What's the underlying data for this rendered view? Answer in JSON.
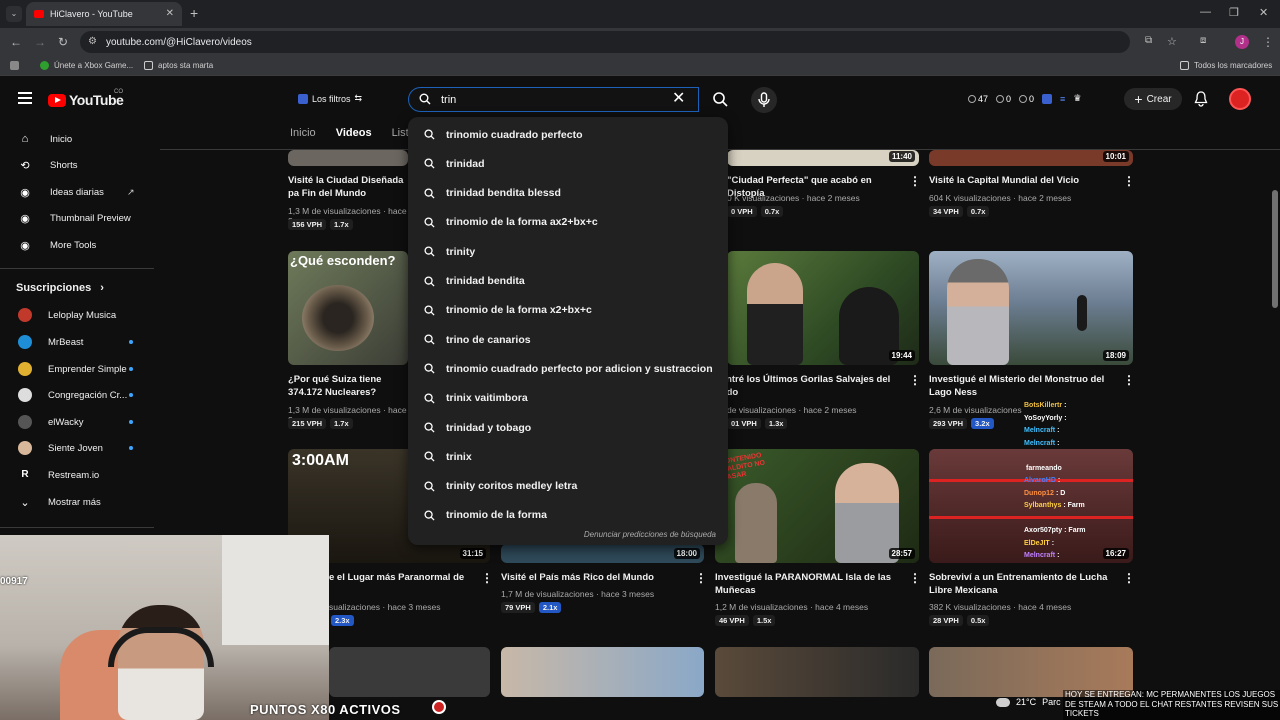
{
  "browser": {
    "tab_title": "HiClavero - YouTube",
    "url": "youtube.com/@HiClavero/videos",
    "bookmarks": [
      "Únete a Xbox Game...",
      "aptos sta marta"
    ],
    "all_bookmarks": "Todos los marcadores",
    "profile_initial": "J"
  },
  "header": {
    "logo_text": "YouTube",
    "logo_region": "CO",
    "filters_label": "Los filtros",
    "search_value": "trin",
    "stats": [
      "47",
      "0",
      "0"
    ],
    "create_label": "Crear"
  },
  "sidebar": {
    "items": [
      {
        "label": "Inicio",
        "icon": "home-icon"
      },
      {
        "label": "Shorts",
        "icon": "shorts-icon"
      },
      {
        "label": "Ideas diarias",
        "icon": "ideas-icon"
      },
      {
        "label": "Thumbnail Preview",
        "icon": "thumbnail-icon"
      },
      {
        "label": "More Tools",
        "icon": "tools-icon"
      }
    ],
    "subscriptions_title": "Suscripciones",
    "subscriptions": [
      {
        "name": "Leloplay Musica",
        "color": "#c0392b",
        "dot": false
      },
      {
        "name": "MrBeast",
        "color": "#1e8fd6",
        "dot": true
      },
      {
        "name": "Emprender Simple",
        "color": "#e0b030",
        "dot": true
      },
      {
        "name": "Congregación Cr...",
        "color": "#dddddd",
        "dot": true
      },
      {
        "name": "elWacky",
        "color": "#555555",
        "dot": true
      },
      {
        "name": "Siente Joven",
        "color": "#d8b89a",
        "dot": true
      },
      {
        "name": "Restream.io",
        "color": "#0f0f0f",
        "dot": false
      }
    ],
    "show_more": "Mostrar más"
  },
  "channel_tabs": [
    "Inicio",
    "Videos",
    "Lista"
  ],
  "suggestions": [
    "trinomio cuadrado perfecto",
    "trinidad",
    "trinidad bendita blessd",
    "trinomio de la forma ax2+bx+c",
    "trinity",
    "trinidad bendita",
    "trinomio de la forma x2+bx+c",
    "trino de canarios",
    "trinomio cuadrado perfecto por adicion y sustraccion",
    "trinix vaitimbora",
    "trinidad y tobago",
    "trinix",
    "trinity coritos medley letra",
    "trinomio de la forma"
  ],
  "report_predictions": "Denunciar predicciones de búsqueda",
  "videos": {
    "row1": [
      {
        "title": "Visité la Ciudad Diseñada pa Fin del Mundo",
        "meta": "1,3 M de visualizaciones · hace 2",
        "vph": "156 VPH",
        "mult": "1.7x",
        "duration": ""
      },
      {
        "title": "\"Ciudad Perfecta\" que acabó en Distopía",
        "meta": "0 K visualizaciones · hace 2 meses",
        "vph": "0 VPH",
        "mult": "0.7x",
        "duration": "11:40"
      },
      {
        "title": "Visité la Capital Mundial del Vicio",
        "meta": "604 K visualizaciones · hace 2 meses",
        "vph": "34 VPH",
        "mult": "0.7x",
        "duration": "10:01"
      }
    ],
    "row2": [
      {
        "title": "¿Por qué Suiza tiene 374.172 Nucleares?",
        "meta": "1,3 M de visualizaciones · hace 2",
        "vph": "215 VPH",
        "mult": "1.7x",
        "duration": "",
        "overlay": "¿Qué esconden?"
      },
      {
        "title": "contré los Últimos Gorilas Salvajes del undo",
        "meta": "de visualizaciones · hace 2 meses",
        "vph": "01 VPH",
        "mult": "1.3x",
        "duration": "19:44"
      },
      {
        "title": "Investigué el Misterio del Monstruo del Lago Ness",
        "meta": "2,6 M de visualizaciones",
        "vph": "293 VPH",
        "mult": "3.2x",
        "duration": "18:09"
      }
    ],
    "row3": [
      {
        "title": "e el Lugar más Paranormal de",
        "meta": "sualizaciones · hace 3 meses",
        "vph": "",
        "mult": "2.3x",
        "duration": "31:15",
        "overlay": "3:00AM"
      },
      {
        "title": "Visité el País más Rico del Mundo",
        "meta": "1,7 M de visualizaciones · hace 3 meses",
        "vph": "79 VPH",
        "mult": "2.1x",
        "duration": "18:00"
      },
      {
        "title": "Investigué la PARANORMAL Isla de las Muñecas",
        "meta": "1,2 M de visualizaciones · hace 4 meses",
        "vph": "46 VPH",
        "mult": "1.5x",
        "duration": "28:57",
        "overlay": "CONTENIDO MALDITO NO PASAR"
      },
      {
        "title": "Sobreviví a un Entrenamiento de Lucha Libre Mexicana",
        "meta": "382 K visualizaciones · hace 4 meses",
        "vph": "28 VPH",
        "mult": "0.5x",
        "duration": "16:27"
      }
    ]
  },
  "chat": [
    {
      "user": "BotsKillertr",
      "msg": ":"
    },
    {
      "user": "YoSoyYorly",
      "msg": ":"
    },
    {
      "user": "Melncraft",
      "msg": ":"
    },
    {
      "user": "Melncraft",
      "msg": ":"
    },
    {
      "user": "",
      "msg": ""
    },
    {
      "user": "",
      "msg": "farmeando"
    },
    {
      "user": "AlvaroHD",
      "msg": ":"
    },
    {
      "user": "Dunop12",
      "msg": ": D"
    },
    {
      "user": "Sylbanthys",
      "msg": ": Farm"
    },
    {
      "user": "",
      "msg": ""
    },
    {
      "user": "Axor507pty",
      "msg": ": Farm"
    },
    {
      "user": "ElDeJIT",
      "msg": ":"
    },
    {
      "user": "Melncraft",
      "msg": ":"
    }
  ],
  "webcam_tag": "00917",
  "points_banner": "PUNTOS X80 ACTIVOS",
  "ticker": "HOY SE ENTREGAN: MC PERMANENTES LOS JUEGOS DE STEAM A TODO EL CHAT RESTANTES REVISEN SUS TICKETS",
  "weather": {
    "temp": "21°C",
    "label": "Parc"
  }
}
